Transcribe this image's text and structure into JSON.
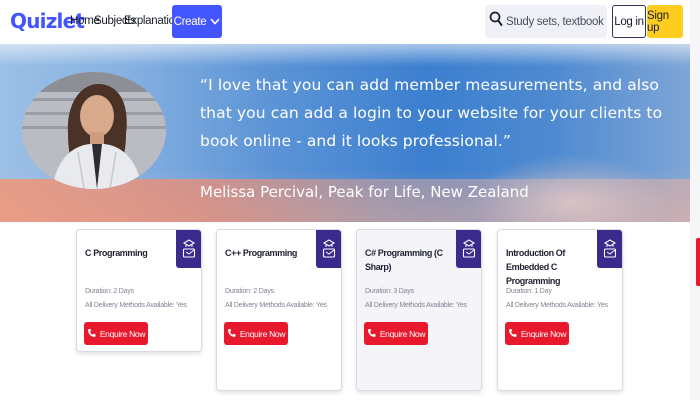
{
  "header": {
    "logo": "Quizlet",
    "nav": [
      "Home",
      "Subjects",
      "Explanations"
    ],
    "create_label": "Create",
    "search_placeholder": "Study sets, textbooks, ...",
    "login_label": "Log in",
    "signup_label": "Sign up"
  },
  "banner": {
    "quote": "“I love that you can add member measurements, and also that you can add a login to your website for your clients to book online - and it looks professional.”",
    "author": "Melissa Percival, Peak for Life, New Zealand"
  },
  "cards": [
    {
      "title": "C Programming",
      "duration": "Duration: 2 Days",
      "delivery": "All Delivery Methods Available: Yes",
      "button": "Enquire Now"
    },
    {
      "title": "C++ Programming",
      "duration": "Duration: 2 Days",
      "delivery": "All Delivery Methods Available: Yes",
      "button": "Enquire Now"
    },
    {
      "title": "C# Programming (C Sharp)",
      "duration": "Duration: 3 Days",
      "delivery": "All Delivery Methods Available: Yes",
      "button": "Enquire Now"
    },
    {
      "title": "Introduction Of Embedded C Programming",
      "duration": "Duration: 1 Day",
      "delivery": "All Delivery Methods Available: Yes",
      "button": "Enquire Now"
    }
  ],
  "icons": {
    "search": "search-icon",
    "chevron": "chevron-down-icon",
    "badge": "course-badge-icon",
    "phone": "phone-icon"
  },
  "colors": {
    "brand": "#4255ff",
    "signup": "#ffcd1f",
    "badge": "#3a2a8c",
    "enquire": "#e8192c"
  }
}
